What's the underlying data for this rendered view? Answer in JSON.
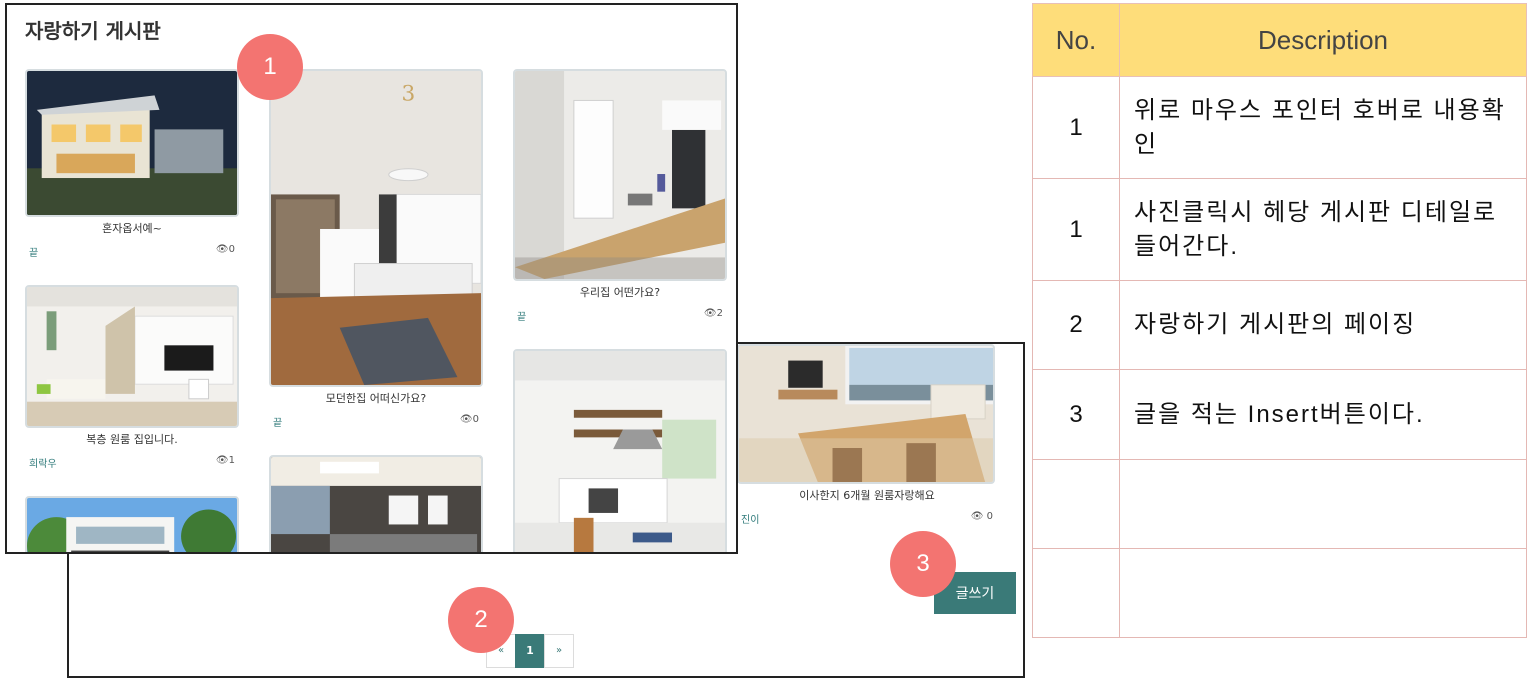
{
  "board": {
    "title": "자랑하기 게시판",
    "columns": [
      [
        {
          "caption": "혼자옵서예~",
          "author": "끝",
          "views": "0"
        },
        {
          "caption": "복층 원룸 집입니다.",
          "author": "희락우",
          "views": "1"
        },
        {
          "caption": "",
          "author": "",
          "views": ""
        }
      ],
      [
        {
          "caption": "모던한집 어떠신가요?",
          "author": "끝",
          "views": "0"
        },
        {
          "caption": "",
          "author": "",
          "views": ""
        }
      ],
      [
        {
          "caption": "우리집 어떤가요?",
          "author": "끝",
          "views": "2"
        },
        {
          "caption": "",
          "author": "",
          "views": ""
        }
      ]
    ],
    "right_card": {
      "caption": "이사한지 6개월 원룸자랑해요",
      "author": "진이",
      "views": "0"
    }
  },
  "write_button": "글쓰기",
  "pagination": {
    "prev": "«",
    "current": "1",
    "next": "»"
  },
  "markers": [
    "1",
    "2",
    "3"
  ],
  "table": {
    "headers": [
      "No.",
      "Description"
    ],
    "rows": [
      {
        "no": "1",
        "desc": "위로 마우스 포인터 호버로 내용확인"
      },
      {
        "no": "1",
        "desc": "사진클릭시 헤당 게시판 디테일로 들어간다."
      },
      {
        "no": "2",
        "desc": "자랑하기 게시판의 페이징"
      },
      {
        "no": "3",
        "desc": "글을 적는 Insert버튼이다."
      },
      {
        "no": "",
        "desc": ""
      },
      {
        "no": "",
        "desc": ""
      }
    ]
  },
  "colors": {
    "accent": "#3a7a78",
    "marker": "#f37471",
    "table_header": "#fedd7a",
    "table_border": "#e4b8b4"
  }
}
